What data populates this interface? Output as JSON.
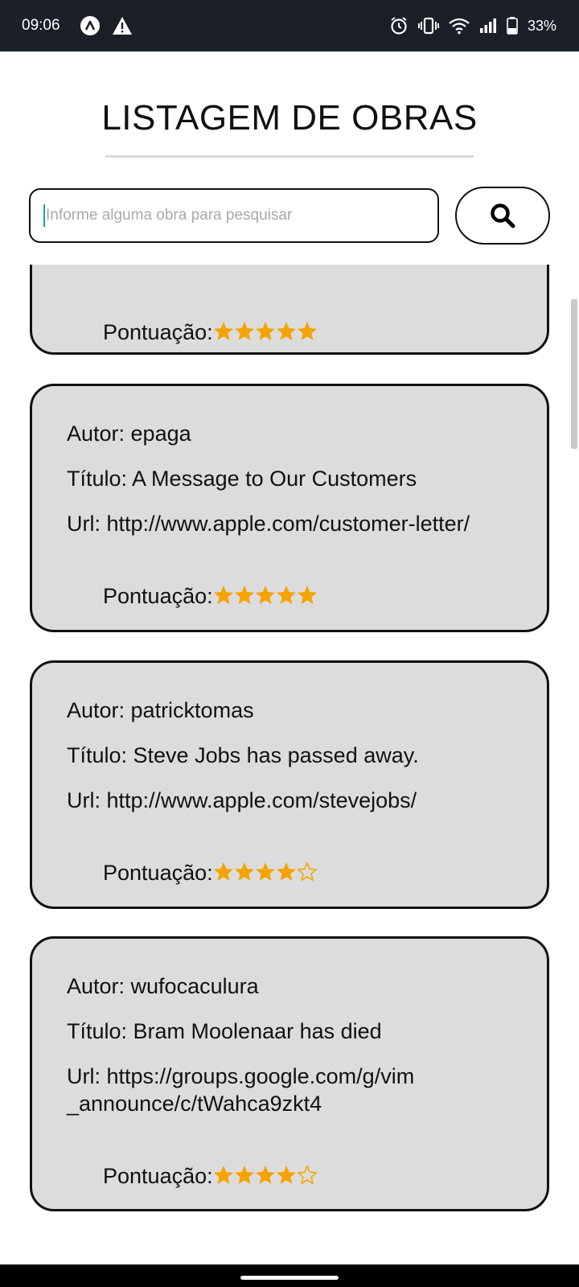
{
  "status_bar": {
    "time": "09:06",
    "battery": "33%",
    "icons": [
      "notification-a-icon",
      "warning-icon",
      "alarm-icon",
      "vibrate-icon",
      "wifi-icon",
      "signal-icon",
      "battery-icon"
    ]
  },
  "header": {
    "title": "LISTAGEM DE OBRAS"
  },
  "search": {
    "placeholder": "Informe alguma obra para pesquisar",
    "value": "",
    "button_icon": "search-icon"
  },
  "colors": {
    "star": "#f5a300",
    "card_bg": "#dcdcdc",
    "status_bar": "#1b1f27"
  },
  "score_label": "Pontuação:",
  "items": [
    {
      "score": 5,
      "partial": true
    },
    {
      "author": "Autor: epaga",
      "title": "Título: A Message to Our Customers",
      "url": "Url: http://www.apple.com/customer-letter/",
      "score": 5
    },
    {
      "author": "Autor: patricktomas",
      "title": "Título: Steve Jobs has passed away.",
      "url": "Url: http://www.apple.com/stevejobs/",
      "score": 4
    },
    {
      "author": "Autor: wufocaculura",
      "title": "Título: Bram Moolenaar has died",
      "url": "Url: https://groups.google.com/g/vim\n_announce/c/tWahca9zkt4",
      "score": 4
    }
  ]
}
